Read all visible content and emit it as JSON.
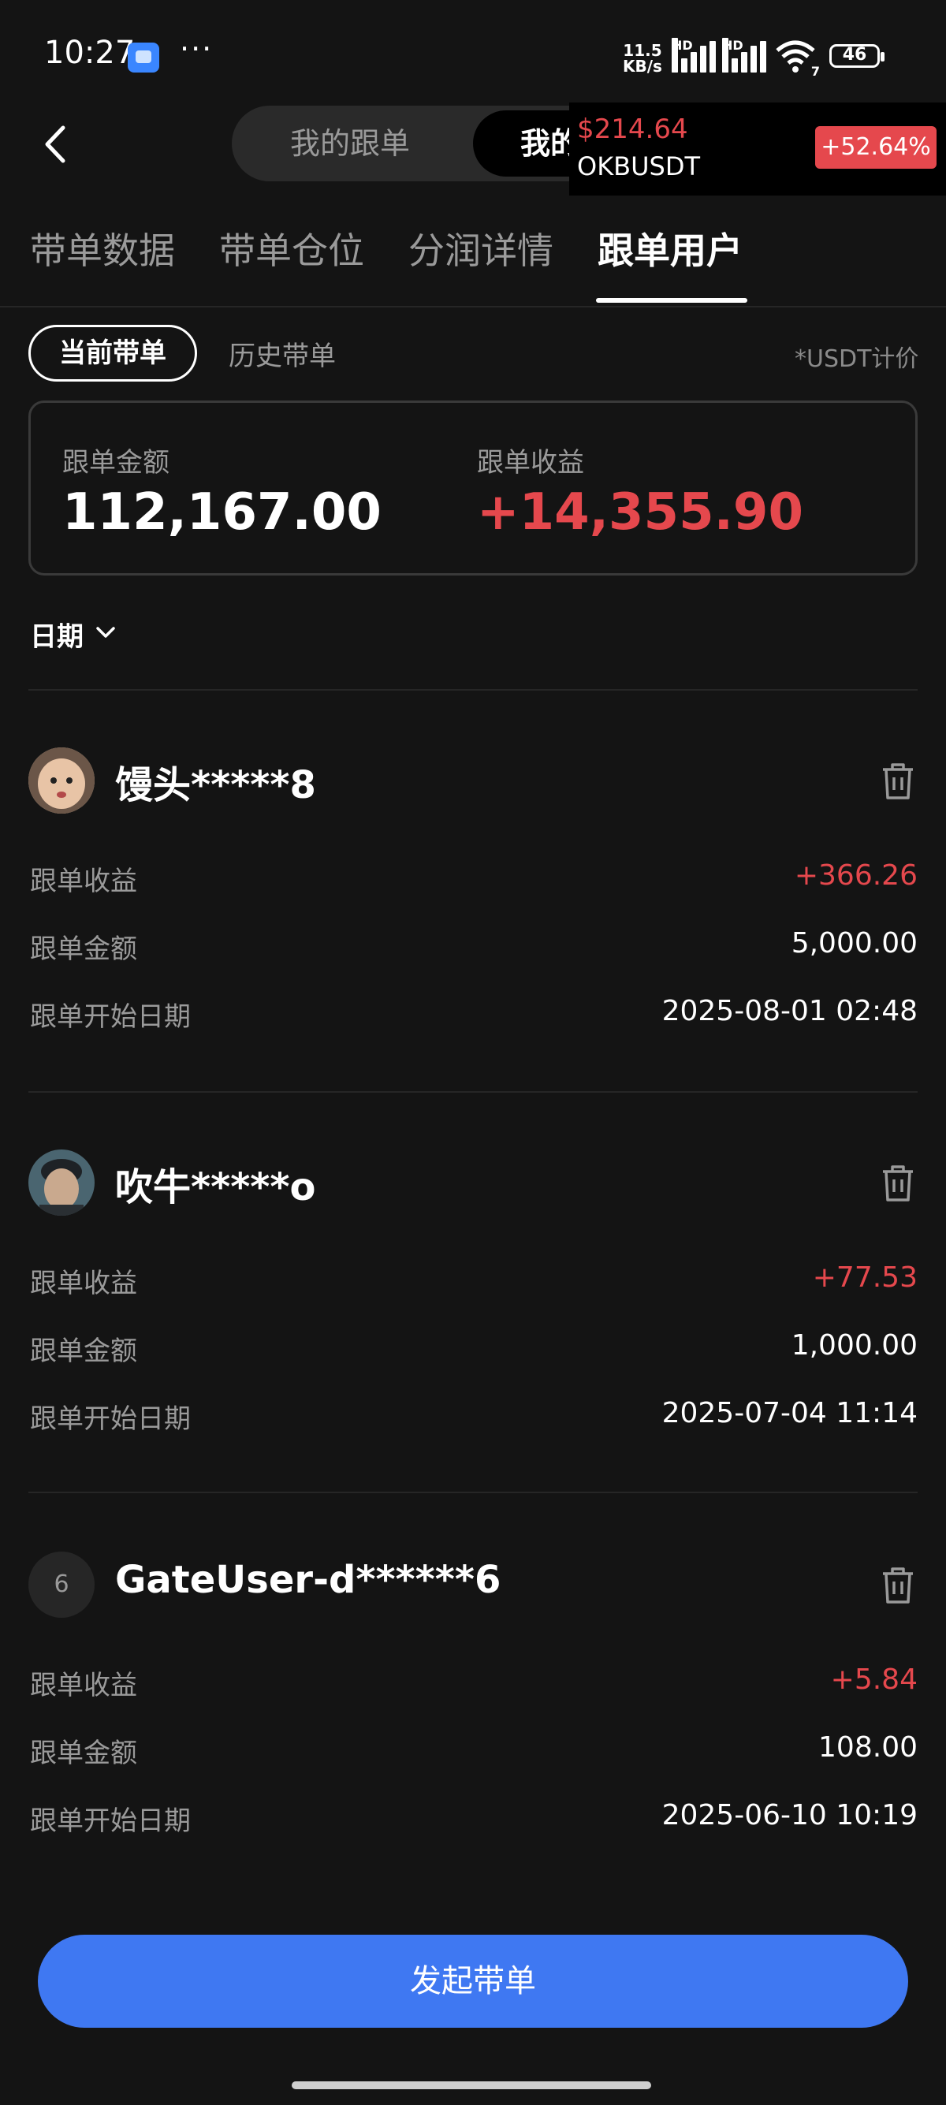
{
  "status_bar": {
    "time": "10:27",
    "dots": "···",
    "net_speed_value": "11.5",
    "net_speed_unit": "KB/s",
    "hd1": "HD",
    "hd2": "HD",
    "wifi_sub": "7",
    "battery": "46"
  },
  "header": {
    "segment_options": [
      "我的跟单",
      "我的带单"
    ]
  },
  "ticker": {
    "price": "$214.64",
    "symbol": "OKBUSDT",
    "change": "+52.64%"
  },
  "tabs": [
    "带单数据",
    "带单仓位",
    "分润详情",
    "跟单用户"
  ],
  "filters": {
    "current": "当前带单",
    "history": "历史带单",
    "unit_note": "*USDT计价"
  },
  "summary": {
    "amount_label": "跟单金额",
    "amount_value": "112,167.00",
    "profit_label": "跟单收益",
    "profit_value": "+14,355.90"
  },
  "date_filter": {
    "label": "日期"
  },
  "row_labels": {
    "profit": "跟单收益",
    "amount": "跟单金额",
    "start": "跟单开始日期"
  },
  "users": [
    {
      "name": "馒头*****8",
      "profit": "+366.26",
      "amount": "5,000.00",
      "start_date": "2025-08-01 02:48"
    },
    {
      "name": "吹牛*****o",
      "profit": "+77.53",
      "amount": "1,000.00",
      "start_date": "2025-07-04 11:14"
    },
    {
      "name": "GateUser-d******6",
      "avatar_initial": "6",
      "profit": "+5.84",
      "amount": "108.00",
      "start_date": "2025-06-10 10:19"
    }
  ],
  "cta": {
    "label": "发起带单"
  },
  "colors": {
    "accent_blue": "#3f78f2",
    "profit_red": "#e5484d",
    "background": "#141414"
  }
}
